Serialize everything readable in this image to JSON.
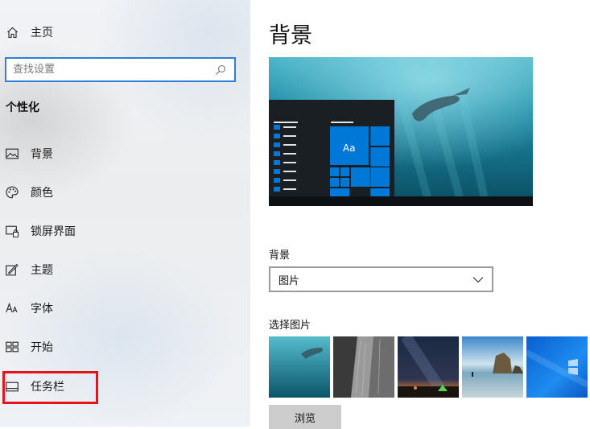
{
  "sidebar": {
    "home_label": "主页",
    "search": {
      "placeholder": "查找设置",
      "value": ""
    },
    "section_title": "个性化",
    "items": [
      {
        "label": "背景",
        "icon": "picture-icon"
      },
      {
        "label": "颜色",
        "icon": "palette-icon"
      },
      {
        "label": "锁屏界面",
        "icon": "lock-screen-icon"
      },
      {
        "label": "主题",
        "icon": "theme-brush-icon"
      },
      {
        "label": "字体",
        "icon": "font-icon"
      },
      {
        "label": "开始",
        "icon": "start-layout-icon"
      },
      {
        "label": "任务栏",
        "icon": "taskbar-icon"
      }
    ],
    "highlight_color": "#e3141b"
  },
  "main": {
    "title": "背景",
    "preview_tile_label": "Aa",
    "background_field": {
      "label": "背景",
      "selected": "图片"
    },
    "choose_picture_label": "选择图片",
    "thumbnails": [
      "underwater",
      "rock-cliff",
      "night-sky-tent",
      "beach-rocks",
      "windows-logo"
    ],
    "browse_label": "浏览"
  },
  "colors": {
    "accent": "#0078d7",
    "search_border": "#2f7fd4"
  }
}
